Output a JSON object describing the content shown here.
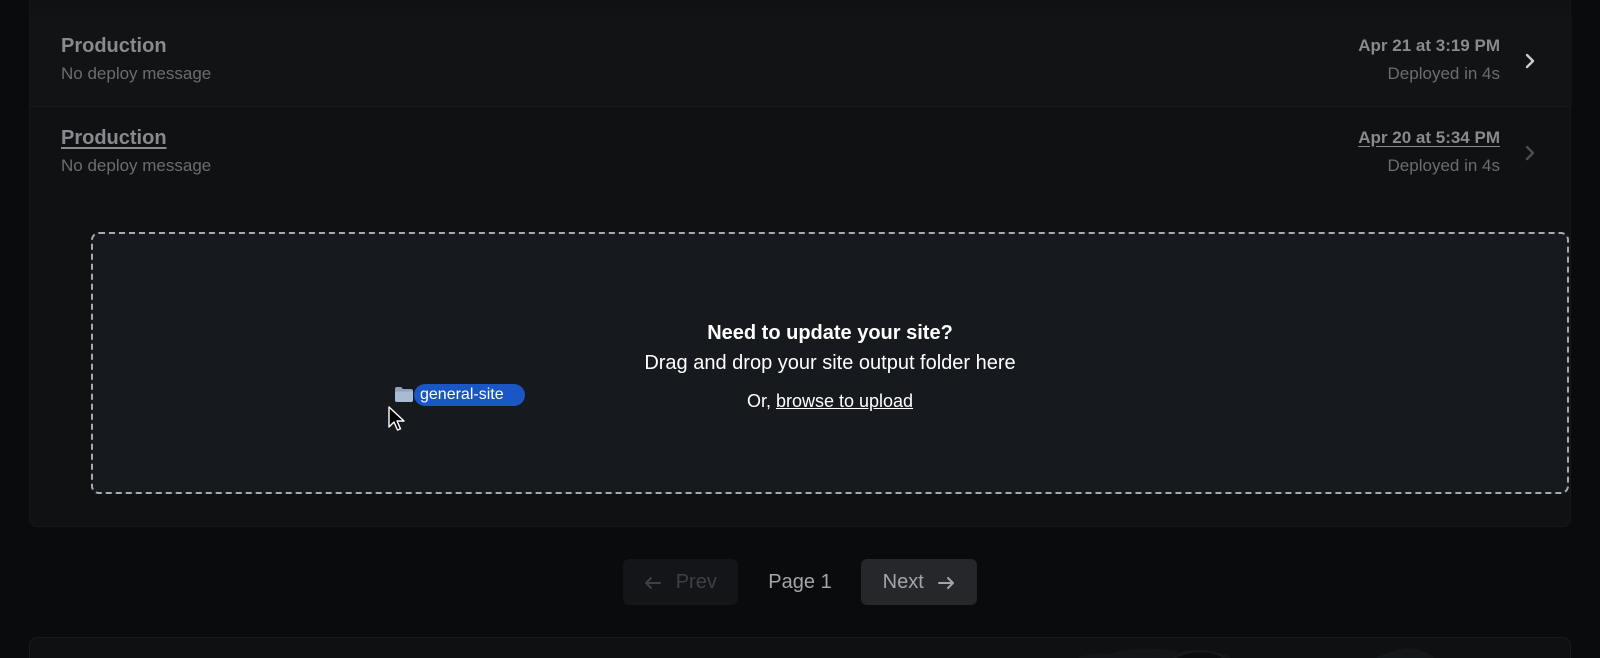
{
  "deploys": [
    {
      "title": "Production",
      "message": "No deploy message",
      "time": "Apr 21 at 3:19 PM",
      "duration": "Deployed in 4s"
    },
    {
      "title": "Production",
      "message": "No deploy message",
      "time": "Apr 20 at 5:34 PM",
      "duration": "Deployed in 4s"
    }
  ],
  "dropzone": {
    "heading": "Need to update your site?",
    "subheading": "Drag and drop your site output folder here",
    "or_text": "Or,",
    "browse_label": "browse to upload"
  },
  "drag_item": {
    "name": "general-site",
    "icon": "folder-icon"
  },
  "pagination": {
    "prev_label": "Prev",
    "page_label": "Page 1",
    "next_label": "Next"
  },
  "colors": {
    "background": "#0a0b0d",
    "dropzone_bg": "#161a1e",
    "drag_pill": "#1a56c4",
    "muted_text": "#878a8f"
  }
}
